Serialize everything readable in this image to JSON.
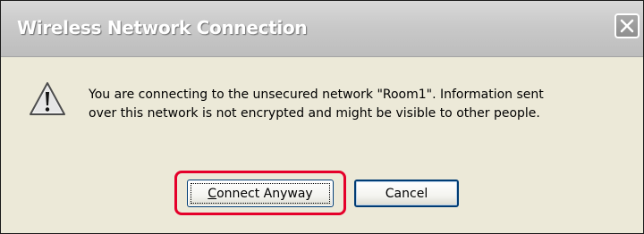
{
  "window": {
    "title": "Wireless Network Connection"
  },
  "message": {
    "line1": "You are connecting to the unsecured network \"Room1\". Information sent",
    "line2": "over this network is not encrypted and might be visible to other people."
  },
  "buttons": {
    "connect_anyway": {
      "mnemonic": "C",
      "rest": "onnect Anyway"
    },
    "cancel": "Cancel"
  },
  "icons": {
    "close": "close-icon",
    "warning": "warning-icon"
  },
  "colors": {
    "highlight": "#e5002a",
    "dialog_background": "#ece9d8"
  }
}
